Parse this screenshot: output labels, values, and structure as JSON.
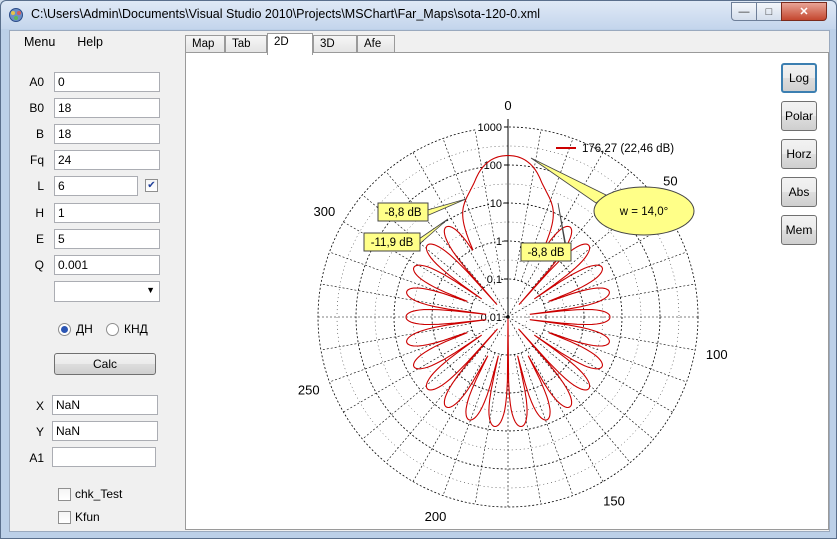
{
  "window": {
    "title": "C:\\Users\\Admin\\Documents\\Visual Studio 2010\\Projects\\MSChart\\Far_Maps\\sota-120-0.xml",
    "app_icon": "mschart-app-icon",
    "buttons": {
      "minimize": "—",
      "maximize": "□",
      "close": "✕"
    }
  },
  "menu": [
    "Menu",
    "Help"
  ],
  "params": {
    "A0": {
      "label": "A0",
      "value": "0"
    },
    "B0": {
      "label": "B0",
      "value": "18"
    },
    "B": {
      "label": "B",
      "value": "18"
    },
    "Fq": {
      "label": "Fq",
      "value": "24"
    },
    "L": {
      "label": "L",
      "value": "6",
      "checked": true
    },
    "H": {
      "label": "H",
      "value": "1"
    },
    "E": {
      "label": "E",
      "value": "5"
    },
    "Q": {
      "label": "Q",
      "value": "0.001"
    },
    "combo_value": ""
  },
  "radio": {
    "option1": "ДН",
    "option2": "КНД",
    "selected": "ДН"
  },
  "calc_label": "Calc",
  "outputs": {
    "X": {
      "label": "X",
      "value": "NaN"
    },
    "Y": {
      "label": "Y",
      "value": "NaN"
    },
    "A1": {
      "label": "A1",
      "value": ""
    }
  },
  "checks": {
    "chk_test": {
      "label": "chk_Test",
      "checked": false
    },
    "kfun": {
      "label": "Kfun",
      "checked": false
    }
  },
  "tabs": [
    "Map",
    "Tab",
    "2D",
    "3D",
    "Afe"
  ],
  "active_tab": "2D",
  "side_buttons": [
    "Log",
    "Polar",
    "Horz",
    "Abs",
    "Mem"
  ],
  "chart_data": {
    "type": "polar",
    "angle_labels": [
      {
        "deg": 0,
        "text": "0"
      },
      {
        "deg": 50,
        "text": "50"
      },
      {
        "deg": 100,
        "text": "100"
      },
      {
        "deg": 150,
        "text": "150"
      },
      {
        "deg": 200,
        "text": "200"
      },
      {
        "deg": 250,
        "text": "250"
      },
      {
        "deg": 300,
        "text": "300"
      }
    ],
    "radial_scale": "log",
    "radial_ticks": [
      "0,01",
      "0,1",
      "1",
      "10",
      "100",
      "1000"
    ],
    "radial_range": [
      0.01,
      1000
    ],
    "grid": true,
    "series": [
      {
        "name": "176,27 (22,46 dB)",
        "color": "#cc0000",
        "main_lobe_peak": 176.27,
        "lobes_per_quadrant_pattern": "13 symmetric lobes"
      }
    ],
    "legend_position": "top-right",
    "annotations": {
      "width": "w = 14,0°",
      "sidelobe_left_1": "-8,8 dB",
      "sidelobe_left_2": "-11,9 dB",
      "sidelobe_right": "-8,8 dB"
    },
    "colors": {
      "callout_fill": "#ffff88",
      "callout_border": "#444444",
      "grid": "#000000"
    }
  }
}
